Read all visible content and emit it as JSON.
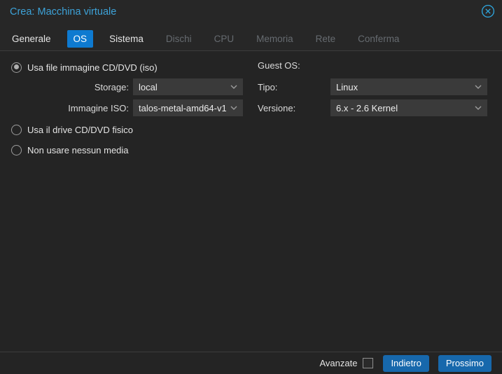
{
  "window": {
    "title": "Crea: Macchina virtuale"
  },
  "tabs": [
    {
      "label": "Generale",
      "state": "enabled"
    },
    {
      "label": "OS",
      "state": "active"
    },
    {
      "label": "Sistema",
      "state": "enabled"
    },
    {
      "label": "Dischi",
      "state": "disabled"
    },
    {
      "label": "CPU",
      "state": "disabled"
    },
    {
      "label": "Memoria",
      "state": "disabled"
    },
    {
      "label": "Rete",
      "state": "disabled"
    },
    {
      "label": "Conferma",
      "state": "disabled"
    }
  ],
  "media": {
    "radios": [
      {
        "label": "Usa file immagine CD/DVD (iso)",
        "selected": true
      },
      {
        "label": "Usa il drive CD/DVD fisico",
        "selected": false
      },
      {
        "label": "Non usare nessun media",
        "selected": false
      }
    ],
    "storage": {
      "label": "Storage:",
      "value": "local"
    },
    "iso": {
      "label": "Immagine ISO:",
      "value": "talos-metal-amd64-v1."
    }
  },
  "guest_os": {
    "heading": "Guest OS:",
    "type": {
      "label": "Tipo:",
      "value": "Linux"
    },
    "version": {
      "label": "Versione:",
      "value": "6.x - 2.6 Kernel"
    }
  },
  "footer": {
    "advanced_label": "Avanzate",
    "advanced_checked": false,
    "back_label": "Indietro",
    "next_label": "Prossimo"
  },
  "colors": {
    "accent_blue": "#0e7ad0",
    "button_blue": "#1768ac",
    "title_blue": "#3da2d8",
    "background": "#242424",
    "field_background": "#3a3a3a",
    "disabled_text": "#666b70"
  }
}
